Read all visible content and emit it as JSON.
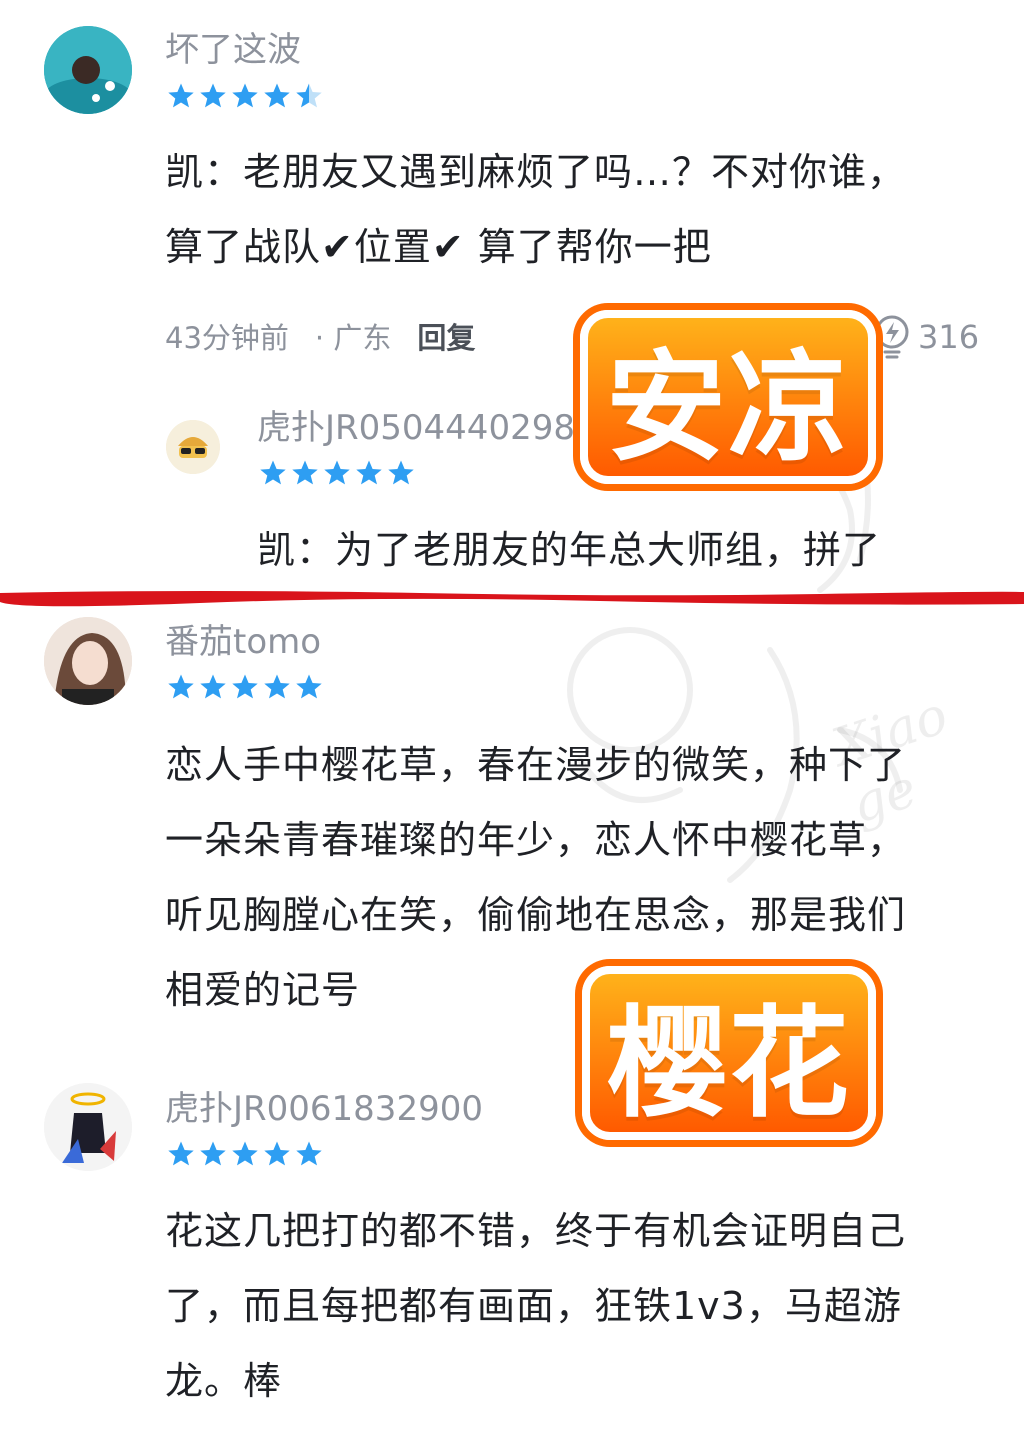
{
  "comments": [
    {
      "username": "坏了这波",
      "rating": 4.5,
      "content_lines": [
        "凯：老朋友又遇到麻烦了吗…？不对你谁，",
        "算了战队✔位置✔ 算了帮你一把"
      ],
      "time": "43分钟前",
      "location": "· 广东",
      "reply_label": "回复",
      "likes": "316",
      "reply": {
        "username": "虎扑JR0504440298",
        "rating": 5,
        "content": "凯：为了老朋友的年总大师组，拼了"
      }
    },
    {
      "username": "番茄tomo",
      "rating": 5,
      "content_lines": [
        "恋人手中樱花草，春在漫步的微笑，种下了",
        "一朵朵青春璀璨的年少，恋人怀中樱花草，",
        "听见胸膛心在笑，偷偷地在思念，那是我们",
        "相爱的记号"
      ]
    },
    {
      "username": "虎扑JR0061832900",
      "rating": 5,
      "content_lines": [
        "花这几把打的都不错，终于有机会证明自己",
        "了，而且每把都有画面，狂铁1v3，马超游",
        "龙。棒"
      ]
    }
  ],
  "stickers": [
    {
      "text": "安凉"
    },
    {
      "text": "樱花"
    }
  ],
  "watermark_text": "Xiao ge",
  "colors": {
    "star": "#2e9ef2",
    "star_empty": "#bfe0f8",
    "divider": "#d9141b",
    "sticker_fill": "#ff6a00",
    "sticker_border": "#ffffff",
    "username": "#8d929c",
    "content": "#1f2126"
  },
  "icons": [
    "bulb-like-icon",
    "star-icon"
  ]
}
